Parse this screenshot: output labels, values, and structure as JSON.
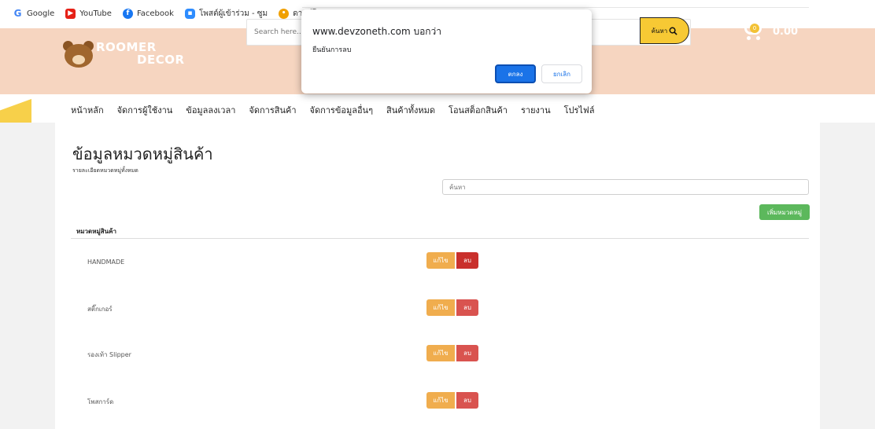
{
  "bookmarks": [
    {
      "label": "Google",
      "icon": "google-icon"
    },
    {
      "label": "YouTube",
      "icon": "youtube-icon"
    },
    {
      "label": "Facebook",
      "icon": "facebook-icon"
    },
    {
      "label": "โพสต์ผู้เข้าร่วม - ซูม",
      "icon": "zoom-icon"
    },
    {
      "label": "ดาวน์โห",
      "icon": "folder-icon"
    }
  ],
  "header": {
    "logo_line1": "ROOMER",
    "logo_line2": "DECOR",
    "search_placeholder": "Search here...",
    "search_button": "ค้นหา",
    "cart_title": "Shopping Cart",
    "cart_total": "0.00",
    "cart_badge": "0"
  },
  "nav": [
    "หน้าหลัก",
    "จัดการผู้ใช้งาน",
    "ข้อมูลลงเวลา",
    "จัดการสินค้า",
    "จัดการข้อมูลอื่นๆ",
    "สินค้าทั้งหมด",
    "โอนสต็อกสินค้า",
    "รายงาน",
    "โปรไฟล์"
  ],
  "page": {
    "title": "ข้อมูลหมวดหมู่สินค้า",
    "subtitle": "รายละเอียดหมวดหมู่ทั้งหมด",
    "filter_placeholder": "ค้นหา",
    "add_button": "เพิ่มหมวดหมู่",
    "column_header": "หมวดหมู่สินค้า",
    "edit_label": "แก้ไข",
    "delete_label": "ลบ",
    "rows": [
      "HANDMADE",
      "สติ๊กเกอร์",
      "รองเท้า Slipper",
      "โพสการ์ด"
    ]
  },
  "dialog": {
    "origin": "www.devzoneth.com บอกว่า",
    "message": "ยืนยันการลบ",
    "ok": "ตกลง",
    "cancel": "ยกเลิก"
  },
  "colors": {
    "header_bg": "#f6d5c0",
    "accent_yellow": "#f7c934",
    "add_green": "#5cb85c",
    "edit_orange": "#f0ad4e",
    "delete_red": "#d9534f",
    "dialog_blue": "#1a73e8"
  }
}
